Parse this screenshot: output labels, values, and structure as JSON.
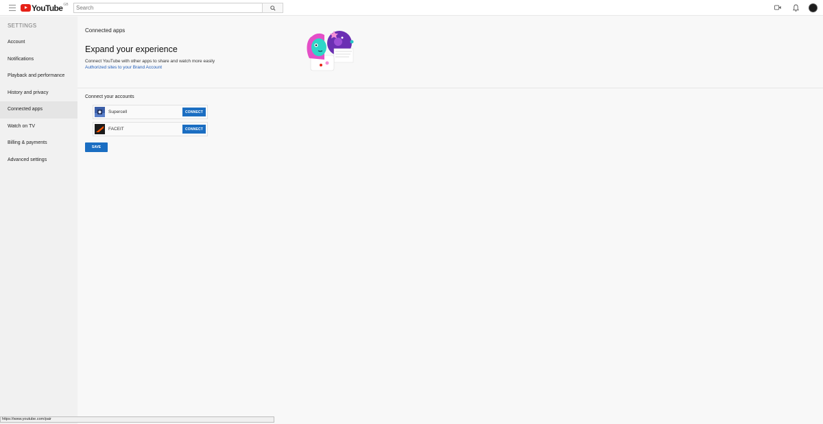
{
  "header": {
    "logo_text": "YouTube",
    "logo_region": "GB",
    "search_placeholder": "Search",
    "icons": [
      "menu-icon",
      "search-icon",
      "upload-video-icon",
      "bell-icon",
      "avatar"
    ]
  },
  "sidebar": {
    "title": "SETTINGS",
    "items": [
      {
        "label": "Account"
      },
      {
        "label": "Notifications"
      },
      {
        "label": "Playback and performance"
      },
      {
        "label": "History and privacy"
      },
      {
        "label": "Connected apps",
        "active": true
      },
      {
        "label": "Watch on TV"
      },
      {
        "label": "Billing & payments"
      },
      {
        "label": "Advanced settings"
      }
    ]
  },
  "main": {
    "heading": "Connected apps",
    "title": "Expand your experience",
    "description": "Connect YouTube with other apps to share and watch more easily",
    "link": "Authorized sites to your Brand Account",
    "section_label": "Connect your accounts",
    "accounts": [
      {
        "name": "Supercell",
        "button": "CONNECT"
      },
      {
        "name": "FACEIT",
        "button": "CONNECT"
      }
    ],
    "save_label": "SAVE"
  },
  "status_bar": {
    "url": "https://www.youtube.com/pair"
  },
  "colors": {
    "brand_red": "#e62117",
    "button_blue": "#1b6ec2",
    "link_blue": "#1e5bb8"
  }
}
